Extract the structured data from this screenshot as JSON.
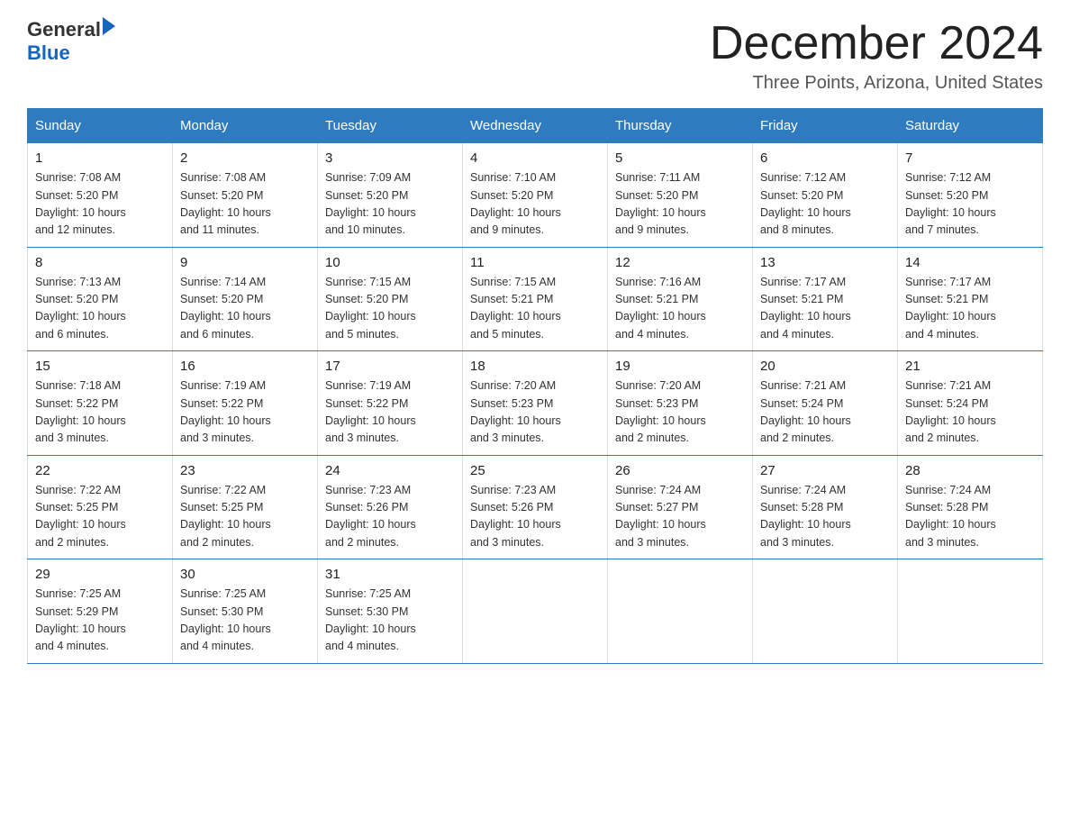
{
  "header": {
    "logo_general": "General",
    "logo_blue": "Blue",
    "month": "December 2024",
    "location": "Three Points, Arizona, United States"
  },
  "weekdays": [
    "Sunday",
    "Monday",
    "Tuesday",
    "Wednesday",
    "Thursday",
    "Friday",
    "Saturday"
  ],
  "weeks": [
    [
      {
        "day": "1",
        "sunrise": "7:08 AM",
        "sunset": "5:20 PM",
        "daylight": "10 hours and 12 minutes."
      },
      {
        "day": "2",
        "sunrise": "7:08 AM",
        "sunset": "5:20 PM",
        "daylight": "10 hours and 11 minutes."
      },
      {
        "day": "3",
        "sunrise": "7:09 AM",
        "sunset": "5:20 PM",
        "daylight": "10 hours and 10 minutes."
      },
      {
        "day": "4",
        "sunrise": "7:10 AM",
        "sunset": "5:20 PM",
        "daylight": "10 hours and 9 minutes."
      },
      {
        "day": "5",
        "sunrise": "7:11 AM",
        "sunset": "5:20 PM",
        "daylight": "10 hours and 9 minutes."
      },
      {
        "day": "6",
        "sunrise": "7:12 AM",
        "sunset": "5:20 PM",
        "daylight": "10 hours and 8 minutes."
      },
      {
        "day": "7",
        "sunrise": "7:12 AM",
        "sunset": "5:20 PM",
        "daylight": "10 hours and 7 minutes."
      }
    ],
    [
      {
        "day": "8",
        "sunrise": "7:13 AM",
        "sunset": "5:20 PM",
        "daylight": "10 hours and 6 minutes."
      },
      {
        "day": "9",
        "sunrise": "7:14 AM",
        "sunset": "5:20 PM",
        "daylight": "10 hours and 6 minutes."
      },
      {
        "day": "10",
        "sunrise": "7:15 AM",
        "sunset": "5:20 PM",
        "daylight": "10 hours and 5 minutes."
      },
      {
        "day": "11",
        "sunrise": "7:15 AM",
        "sunset": "5:21 PM",
        "daylight": "10 hours and 5 minutes."
      },
      {
        "day": "12",
        "sunrise": "7:16 AM",
        "sunset": "5:21 PM",
        "daylight": "10 hours and 4 minutes."
      },
      {
        "day": "13",
        "sunrise": "7:17 AM",
        "sunset": "5:21 PM",
        "daylight": "10 hours and 4 minutes."
      },
      {
        "day": "14",
        "sunrise": "7:17 AM",
        "sunset": "5:21 PM",
        "daylight": "10 hours and 4 minutes."
      }
    ],
    [
      {
        "day": "15",
        "sunrise": "7:18 AM",
        "sunset": "5:22 PM",
        "daylight": "10 hours and 3 minutes."
      },
      {
        "day": "16",
        "sunrise": "7:19 AM",
        "sunset": "5:22 PM",
        "daylight": "10 hours and 3 minutes."
      },
      {
        "day": "17",
        "sunrise": "7:19 AM",
        "sunset": "5:22 PM",
        "daylight": "10 hours and 3 minutes."
      },
      {
        "day": "18",
        "sunrise": "7:20 AM",
        "sunset": "5:23 PM",
        "daylight": "10 hours and 3 minutes."
      },
      {
        "day": "19",
        "sunrise": "7:20 AM",
        "sunset": "5:23 PM",
        "daylight": "10 hours and 2 minutes."
      },
      {
        "day": "20",
        "sunrise": "7:21 AM",
        "sunset": "5:24 PM",
        "daylight": "10 hours and 2 minutes."
      },
      {
        "day": "21",
        "sunrise": "7:21 AM",
        "sunset": "5:24 PM",
        "daylight": "10 hours and 2 minutes."
      }
    ],
    [
      {
        "day": "22",
        "sunrise": "7:22 AM",
        "sunset": "5:25 PM",
        "daylight": "10 hours and 2 minutes."
      },
      {
        "day": "23",
        "sunrise": "7:22 AM",
        "sunset": "5:25 PM",
        "daylight": "10 hours and 2 minutes."
      },
      {
        "day": "24",
        "sunrise": "7:23 AM",
        "sunset": "5:26 PM",
        "daylight": "10 hours and 2 minutes."
      },
      {
        "day": "25",
        "sunrise": "7:23 AM",
        "sunset": "5:26 PM",
        "daylight": "10 hours and 3 minutes."
      },
      {
        "day": "26",
        "sunrise": "7:24 AM",
        "sunset": "5:27 PM",
        "daylight": "10 hours and 3 minutes."
      },
      {
        "day": "27",
        "sunrise": "7:24 AM",
        "sunset": "5:28 PM",
        "daylight": "10 hours and 3 minutes."
      },
      {
        "day": "28",
        "sunrise": "7:24 AM",
        "sunset": "5:28 PM",
        "daylight": "10 hours and 3 minutes."
      }
    ],
    [
      {
        "day": "29",
        "sunrise": "7:25 AM",
        "sunset": "5:29 PM",
        "daylight": "10 hours and 4 minutes."
      },
      {
        "day": "30",
        "sunrise": "7:25 AM",
        "sunset": "5:30 PM",
        "daylight": "10 hours and 4 minutes."
      },
      {
        "day": "31",
        "sunrise": "7:25 AM",
        "sunset": "5:30 PM",
        "daylight": "10 hours and 4 minutes."
      },
      null,
      null,
      null,
      null
    ]
  ],
  "labels": {
    "sunrise": "Sunrise:",
    "sunset": "Sunset:",
    "daylight": "Daylight:"
  }
}
